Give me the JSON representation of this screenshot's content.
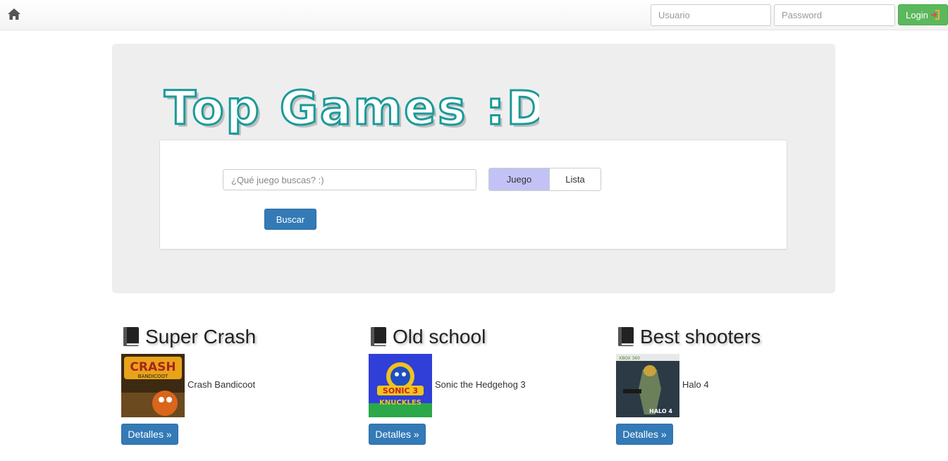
{
  "navbar": {
    "home_icon": "home-icon",
    "username_placeholder": "Usuario",
    "password_placeholder": "Password",
    "login_label": "Login",
    "login_icon": "sign-in-icon"
  },
  "hero": {
    "logo_text": "Top Games :D",
    "search_placeholder": "¿Qué juego buscas? :)",
    "toggle": [
      "Juego",
      "Lista"
    ],
    "toggle_selected": "Juego",
    "search_button": "Buscar"
  },
  "lists": [
    {
      "title": "Super Crash",
      "game": "Crash Bandicoot",
      "button": "Detalles »"
    },
    {
      "title": "Old school",
      "game": "Sonic the Hedgehog 3",
      "button": "Detalles »"
    },
    {
      "title": "Best shooters",
      "game": "Halo 4",
      "button": "Detalles »"
    }
  ],
  "cover_art": {
    "crash": {
      "line1": "CRASH",
      "line2": "BANDICOOT"
    },
    "sonic": {
      "line1": "SONIC 3",
      "line2": "KNUCKLES"
    },
    "halo": {
      "line1": "XBOX 360",
      "line2": "HALO 4"
    }
  },
  "colors": {
    "login_green": "#5cb85c",
    "primary_blue": "#337ab7",
    "jumbotron_bg": "#eeeeee",
    "toggle_selected_bg": "#c3c2f6",
    "logo_teal": "#1a9a9a"
  }
}
